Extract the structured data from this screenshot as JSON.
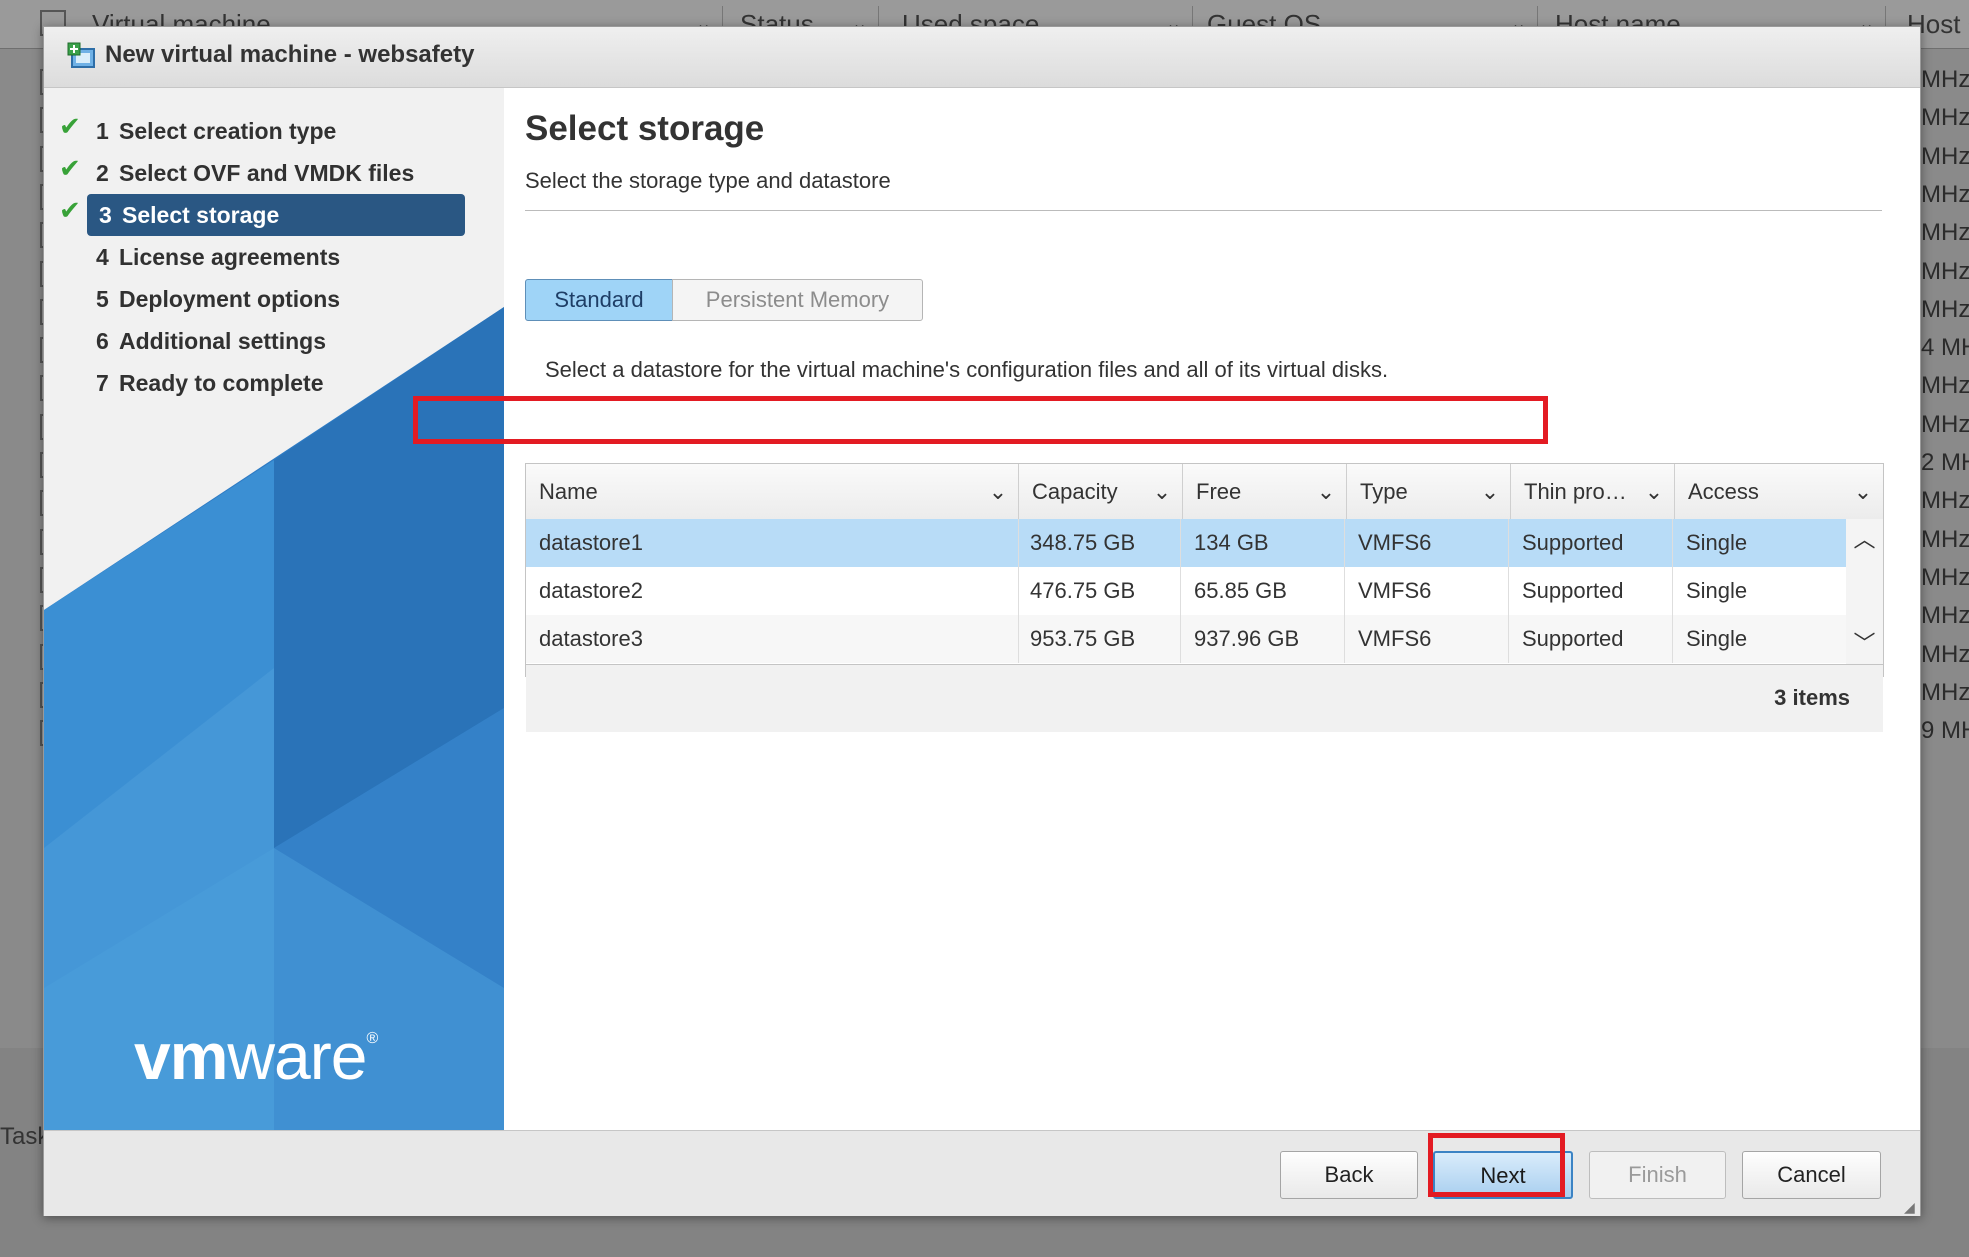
{
  "background": {
    "columns": [
      "Virtual machine",
      "Status",
      "Used space",
      "Guest OS",
      "Host name",
      "Host C"
    ],
    "mhz_labels": [
      "MHz",
      "MHz",
      "MHz",
      "MHz",
      "MHz",
      "MHz",
      "MHz",
      "4 MH",
      "MHz",
      "MHz",
      "2 MH",
      "MHz",
      "MHz",
      "MHz",
      "MHz",
      "MHz",
      "MHz",
      "9 MH"
    ],
    "task_label": "Task"
  },
  "dialog": {
    "title": "New virtual machine - websafety",
    "steps": [
      {
        "num": "1",
        "label": "Select creation type",
        "done": true
      },
      {
        "num": "2",
        "label": "Select OVF and VMDK files",
        "done": true
      },
      {
        "num": "3",
        "label": "Select storage",
        "done": true,
        "active": true
      },
      {
        "num": "4",
        "label": "License agreements"
      },
      {
        "num": "5",
        "label": "Deployment options"
      },
      {
        "num": "6",
        "label": "Additional settings"
      },
      {
        "num": "7",
        "label": "Ready to complete"
      }
    ],
    "logo": {
      "vm": "vm",
      "ware": "ware",
      "reg": "®"
    }
  },
  "content": {
    "title": "Select storage",
    "subtitle": "Select the storage type and datastore",
    "tabs": {
      "standard": "Standard",
      "persistent": "Persistent Memory"
    },
    "instruction": "Select a datastore for the virtual machine's configuration files and all of its virtual disks.",
    "table": {
      "headers": [
        "Name",
        "Capacity",
        "Free",
        "Type",
        "Thin pro…",
        "Access"
      ],
      "rows": [
        [
          "datastore1",
          "348.75 GB",
          "134 GB",
          "VMFS6",
          "Supported",
          "Single"
        ],
        [
          "datastore2",
          "476.75 GB",
          "65.85 GB",
          "VMFS6",
          "Supported",
          "Single"
        ],
        [
          "datastore3",
          "953.75 GB",
          "937.96 GB",
          "VMFS6",
          "Supported",
          "Single"
        ]
      ],
      "item_count": "3 items"
    }
  },
  "footer": {
    "back": "Back",
    "next": "Next",
    "finish": "Finish",
    "cancel": "Cancel"
  },
  "colors": {
    "accent_active_step": "#2a5783",
    "selected_row": "#b8dcf7",
    "highlight": "#e31b23",
    "check": "#38a238"
  }
}
